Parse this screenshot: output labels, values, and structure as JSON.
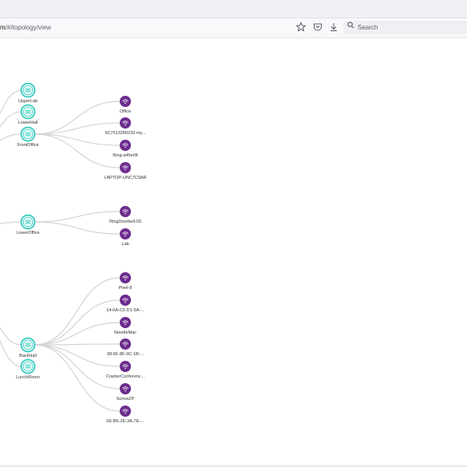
{
  "browser": {
    "url_host": "m",
    "url_path": "/#/topology/view",
    "search_placeholder": "Search",
    "icons": [
      "bookmark-star-icon",
      "pocket-icon",
      "download-icon",
      "search-icon"
    ]
  },
  "colors": {
    "ap_ring": "#22c7b8",
    "client_fill": "#6c2b8e",
    "edge": "#d4d4d4"
  },
  "topology": {
    "access_points": [
      {
        "id": "ap1",
        "label": "UpperLab"
      },
      {
        "id": "ap2",
        "label": "LowerHall"
      },
      {
        "id": "ap3",
        "label": "FrontOffice"
      },
      {
        "id": "ap4",
        "label": "LowerOffice"
      },
      {
        "id": "ap5",
        "label": "BackHall"
      },
      {
        "id": "ap6",
        "label": "LunchRoom"
      }
    ],
    "clients": [
      {
        "id": "c1",
        "label": "Office",
        "ap": "ap3"
      },
      {
        "id": "c2",
        "label": "9C7613280232-my...",
        "ap": "ap3"
      },
      {
        "id": "c3",
        "label": "Ring-a45e08",
        "ap": "ap3"
      },
      {
        "id": "c4",
        "label": "LAPTOP-UNC7C9AR",
        "ap": "ap3"
      },
      {
        "id": "c5",
        "label": "RingDoorbell-03",
        "ap": "ap4"
      },
      {
        "id": "c6",
        "label": "Lab",
        "ap": "ap4"
      },
      {
        "id": "c7",
        "label": "Pixel-8",
        "ap": "ap5"
      },
      {
        "id": "c8",
        "label": "14-0A-C5-D1-5A-...",
        "ap": "ap5"
      },
      {
        "id": "c9",
        "label": "NoodleMac",
        "ap": "ap5"
      },
      {
        "id": "c10",
        "label": "38-6F-8F-0C-1B-...",
        "ap": "ap5"
      },
      {
        "id": "c11",
        "label": "CramerConferenc...",
        "ap": "ap5"
      },
      {
        "id": "c12",
        "label": "SonosZP",
        "ap": "ap5"
      },
      {
        "id": "c13",
        "label": "0E-B6-2E-3A-7E-...",
        "ap": "ap5"
      }
    ]
  }
}
